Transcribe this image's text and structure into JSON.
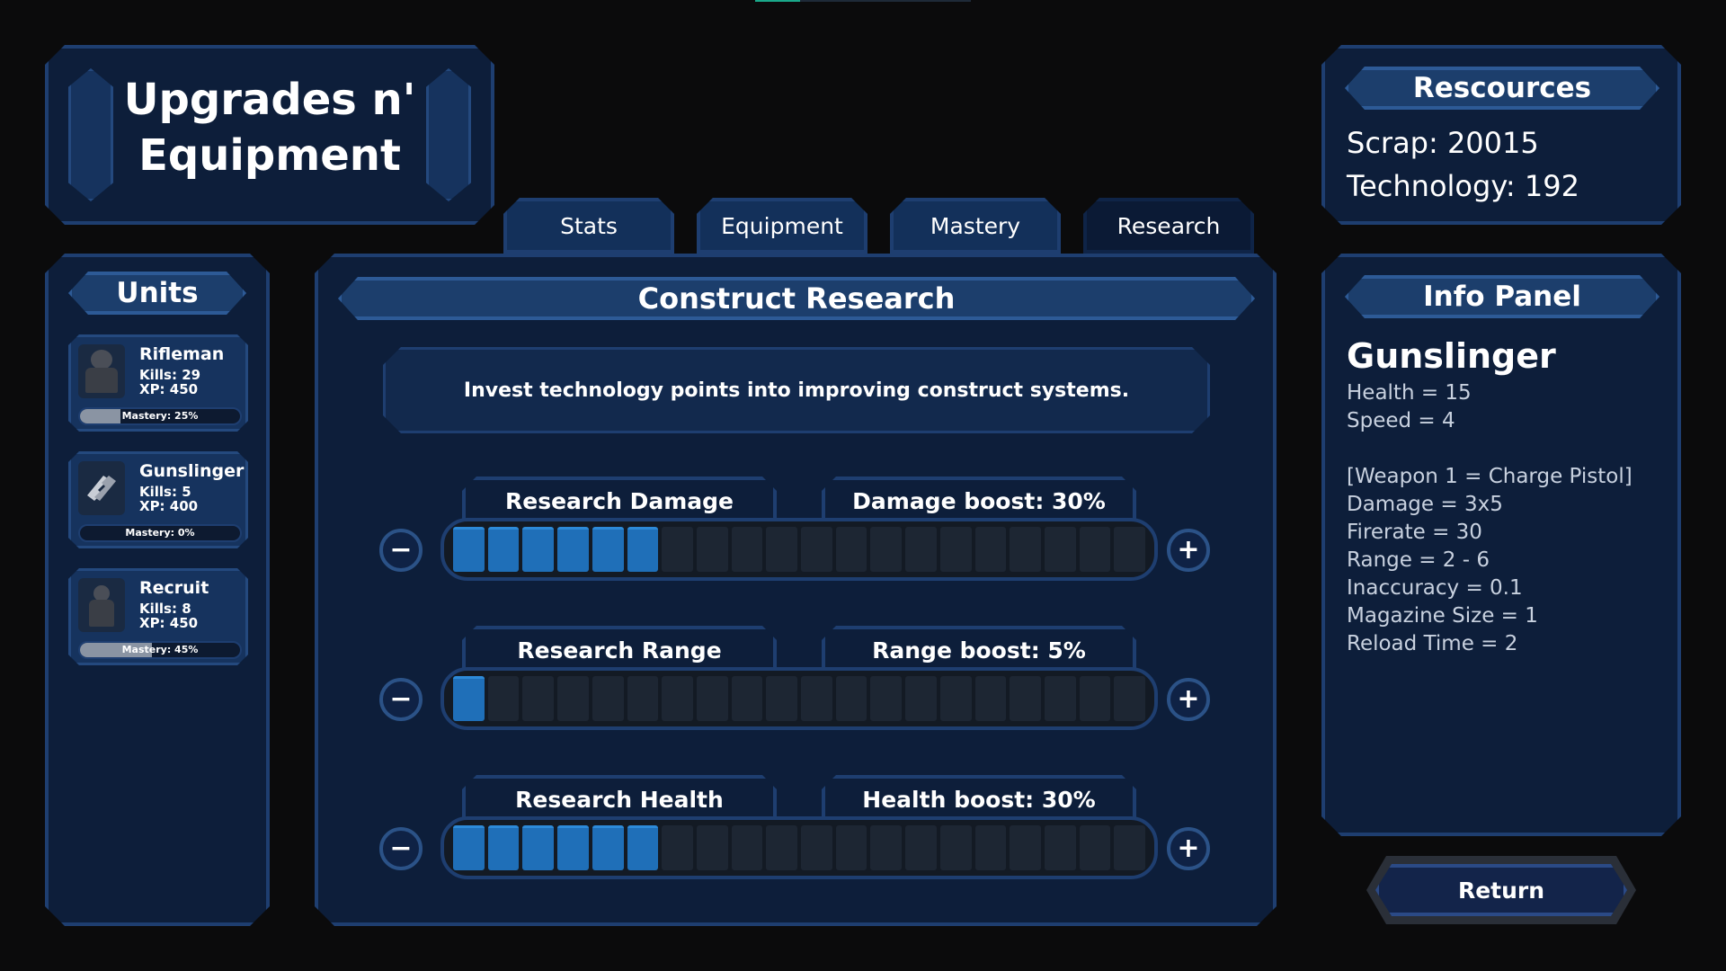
{
  "title": {
    "line1": "Upgrades n'",
    "line2": "Equipment"
  },
  "tabs": [
    {
      "label": "Stats",
      "active": false
    },
    {
      "label": "Equipment",
      "active": false
    },
    {
      "label": "Mastery",
      "active": false
    },
    {
      "label": "Research",
      "active": true
    }
  ],
  "units_panel": {
    "heading": "Units",
    "units": [
      {
        "name": "Rifleman",
        "kills": "Kills: 29",
        "xp": "XP: 450",
        "mastery_label": "Mastery: 25%",
        "mastery": 0.25,
        "icon": "rifleman-portrait-icon"
      },
      {
        "name": "Gunslinger",
        "kills": "Kills: 5",
        "xp": "XP: 400",
        "mastery_label": "Mastery: 0%",
        "mastery": 0.0,
        "icon": "gunslinger-pistols-icon"
      },
      {
        "name": "Recruit",
        "kills": "Kills: 8",
        "xp": "XP: 450",
        "mastery_label": "Mastery: 45%",
        "mastery": 0.45,
        "icon": "recruit-portrait-icon"
      }
    ]
  },
  "research": {
    "heading": "Construct Research",
    "description": "Invest technology points into improving construct systems.",
    "rows": [
      {
        "label": "Research Damage",
        "boost": "Damage boost: 30%",
        "level": 6,
        "max": 20
      },
      {
        "label": "Research Range",
        "boost": "Range boost: 5%",
        "level": 1,
        "max": 20
      },
      {
        "label": "Research Health",
        "boost": "Health boost: 30%",
        "level": 6,
        "max": 20
      }
    ],
    "minus_symbol": "−",
    "plus_symbol": "+"
  },
  "resources": {
    "heading": "Rescources",
    "scrap": "Scrap: 20015",
    "technology": "Technology: 192"
  },
  "info_panel": {
    "heading": "Info Panel",
    "unit_name": "Gunslinger",
    "stats": [
      "Health = 15",
      "Speed = 4"
    ],
    "weapon": "[Weapon 1 = Charge Pistol]",
    "weapon_stats": [
      "Damage = 3x5",
      "Firerate = 30",
      "Range = 2 - 6",
      "Inaccuracy = 0.1",
      "Magazine Size = 1",
      "Reload Time = 2"
    ]
  },
  "return_button": "Return",
  "colors": {
    "background": "#0b0b0c",
    "panel": "#0d1e3a",
    "border": "#1e3e70",
    "banner": "#1c3e6c",
    "progress_fill": "#1f6fb8",
    "top_accent": "#1aa88a"
  }
}
